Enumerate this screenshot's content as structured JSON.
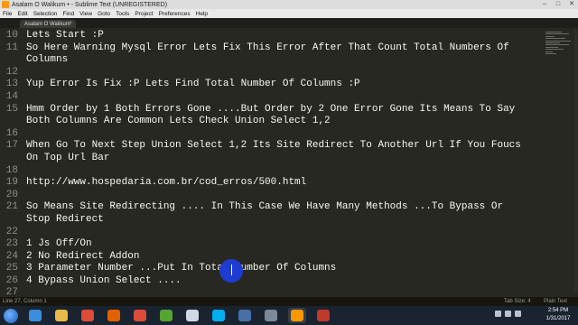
{
  "window": {
    "title": "Asalam O Walikum • - Sublime Text (UNREGISTERED)",
    "controls": [
      "–",
      "□",
      "✕"
    ]
  },
  "menu": [
    "File",
    "Edit",
    "Selection",
    "Find",
    "View",
    "Goto",
    "Tools",
    "Project",
    "Preferences",
    "Help"
  ],
  "tab": {
    "label": "Asalam O Walikum",
    "close": "×"
  },
  "editor": {
    "lines": [
      {
        "num": "10",
        "text": "Lets Start :P"
      },
      {
        "num": "11",
        "text": "So Here Warning Mysql Error Lets Fix This Error After That Count Total Numbers Of"
      },
      {
        "num": "",
        "text": "Columns"
      },
      {
        "num": "12",
        "text": ""
      },
      {
        "num": "13",
        "text": "Yup Error Is Fix :P Lets Find Total Number Of Columns :P"
      },
      {
        "num": "14",
        "text": ""
      },
      {
        "num": "15",
        "text": "Hmm Order by 1 Both Errors Gone ....But Order by 2 One Error Gone Its Means To Say"
      },
      {
        "num": "",
        "text": "Both Columns Are Common Lets Check Union Select 1,2"
      },
      {
        "num": "16",
        "text": ""
      },
      {
        "num": "17",
        "text": "When Go To Next Step Union Select 1,2 Its Site Redirect To Another Url If You Foucs"
      },
      {
        "num": "",
        "text": "On Top Url Bar"
      },
      {
        "num": "18",
        "text": ""
      },
      {
        "num": "19",
        "text": "http://www.hospedaria.com.br/cod_erros/500.html"
      },
      {
        "num": "20",
        "text": ""
      },
      {
        "num": "21",
        "text": "So Means Site Redirecting .... In This Case We Have Many Methods ...To Bypass Or"
      },
      {
        "num": "",
        "text": "Stop Redirect"
      },
      {
        "num": "22",
        "text": ""
      },
      {
        "num": "23",
        "text": "1 Js Off/On"
      },
      {
        "num": "24",
        "text": "2 No Redirect Addon"
      },
      {
        "num": "25",
        "text": "3 Parameter Number ...Put In Total Number Of Columns"
      },
      {
        "num": "26",
        "text": "4 Bypass Union Select ...."
      },
      {
        "num": "27",
        "text": ""
      }
    ]
  },
  "status": {
    "position": "Line 27, Column 1",
    "tab_size": "Tab Size: 4",
    "syntax": "Plain Text"
  },
  "taskbar": {
    "time": "2:54 PM",
    "date": "1/31/2017",
    "apps": [
      {
        "icon": "internet-explorer-icon",
        "color": "#3b8edc"
      },
      {
        "icon": "file-explorer-icon",
        "color": "#e8b84a"
      },
      {
        "icon": "chrome-icon",
        "color": "#dd4b39"
      },
      {
        "icon": "firefox-icon",
        "color": "#e66000"
      },
      {
        "icon": "chrome-icon",
        "color": "#dd4b39"
      },
      {
        "icon": "utorrent-icon",
        "color": "#55a630"
      },
      {
        "icon": "notepad-icon",
        "color": "#cfd8e3"
      },
      {
        "icon": "skype-icon",
        "color": "#00aff0"
      },
      {
        "icon": "media-player-icon",
        "color": "#4a6fa5"
      },
      {
        "icon": "photo-viewer-icon",
        "color": "#7a8a99"
      },
      {
        "icon": "sublime-text-icon",
        "color": "#ff9800"
      },
      {
        "icon": "recording-icon",
        "color": "#c0392b"
      }
    ]
  },
  "cursor": {
    "highlight_color": "#1e3cd2"
  }
}
